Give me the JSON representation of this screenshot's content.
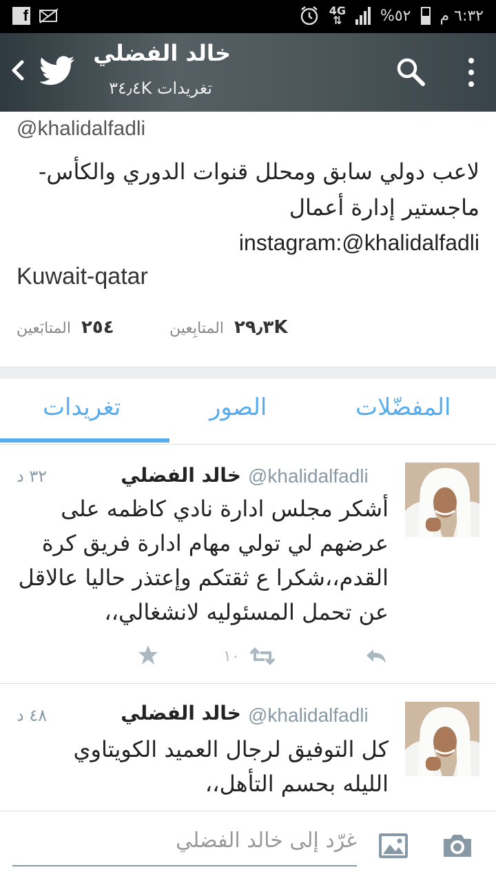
{
  "status_bar": {
    "time": "٦:٣٢ م",
    "battery": "٥٢%",
    "network": "4G"
  },
  "header": {
    "title": "خالد الفضلي",
    "subtitle": "تغريدات ٣٤٫٤K"
  },
  "profile": {
    "handle": "@khalidalfadli",
    "bio_lines": [
      "لاعب دولي سابق ومحلل قنوات الدوري والكأس-",
      "ماجستير إدارة أعمال",
      "instagram:@khalidalfadli"
    ],
    "location": "Kuwait-qatar",
    "followers_count": "٢٩٫٣K",
    "followers_label": "المتابِعين",
    "following_count": "٢٥٤",
    "following_label": "المتابَعين"
  },
  "tabs": [
    {
      "label": "المفضّلات"
    },
    {
      "label": "الصور"
    },
    {
      "label": "تغريدات",
      "active": true
    }
  ],
  "tweets": [
    {
      "name": "خالد الفضلي",
      "handle": "@khalidalfadli",
      "time": "٣٢ د",
      "lines": [
        "أشكر مجلس ادارة نادي كاظمه على",
        "عرضهم لي تولي مهام ادارة فريق كرة",
        "القدم،،شكرا ع ثقتكم وإعتذر حاليا عالاقل",
        "عن تحمل المسئوليه لانشغالي،،"
      ],
      "retweets": "١٠"
    },
    {
      "name": "خالد الفضلي",
      "handle": "@khalidalfadli",
      "time": "٤٨ د",
      "lines": [
        "كل التوفيق لرجال العميد الكويتاوي",
        "الليله بحسم التأهل،،"
      ]
    }
  ],
  "compose": {
    "placeholder": "غرّد إلى خالد الفضلي"
  },
  "colors": {
    "accent": "#55acee",
    "muted": "#8899a6"
  }
}
